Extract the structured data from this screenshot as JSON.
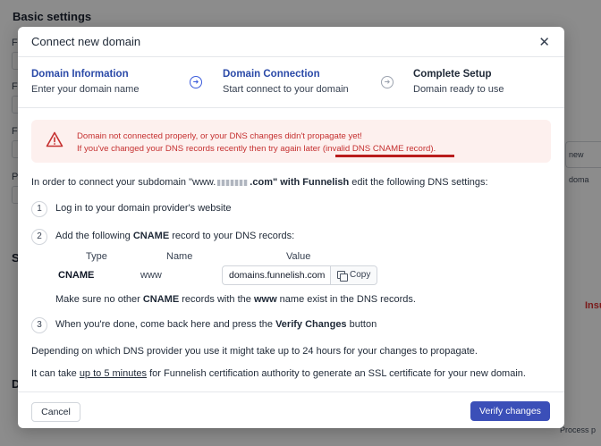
{
  "background": {
    "title": "Basic settings",
    "field_letters": [
      "F",
      "F",
      "F",
      "P"
    ],
    "section_letters": [
      "S",
      "D"
    ],
    "right_fragment": "new doma",
    "red_fragment": "Insu",
    "process_fragment": "Process p"
  },
  "modal": {
    "title": "Connect new domain",
    "close_symbol": "✕",
    "steps": [
      {
        "title": "Domain Information",
        "subtitle": "Enter your domain name"
      },
      {
        "title": "Domain Connection",
        "subtitle": "Start connect to your domain"
      },
      {
        "title": "Complete Setup",
        "subtitle": "Domain ready to use"
      }
    ],
    "alert": {
      "line1": "Domain not connected properly, or your DNS changes didn't propagate yet!",
      "line2": "If you've changed your DNS records recently then try again later (invalid DNS CNAME record)."
    },
    "intro": {
      "before": "In order to connect your subdomain \"www.",
      "after": ".com\" with ",
      "brand": "Funnelish",
      "end": " edit the following DNS settings:"
    },
    "steps_list": {
      "n1": "1",
      "n2": "2",
      "n3": "3",
      "item1": "Log in to your domain provider's website",
      "item2_pre": "Add the following ",
      "item2_bold": "CNAME",
      "item2_post": " record to your DNS records:",
      "item3_pre": "When you're done, come back here and press the ",
      "item3_bold": "Verify Changes",
      "item3_post": " button"
    },
    "dns_table": {
      "headers": [
        "Type",
        "Name",
        "Value"
      ],
      "type": "CNAME",
      "name": "www",
      "value": "domains.funnelish.com",
      "copy_label": "Copy"
    },
    "note": {
      "pre": "Make sure no other ",
      "bold1": "CNAME",
      "mid": " records with the ",
      "bold2": "www",
      "post": " name exist in the DNS records."
    },
    "propagation_text": "Depending on which DNS provider you use it might take up to 24 hours for your changes to propagate.",
    "ssl": {
      "pre": "It can take ",
      "link": "up to 5 minutes",
      "post": " for Funnelish certification authority to generate an SSL certificate for your new domain."
    },
    "cancel_label": "Cancel",
    "verify_label": "Verify changes"
  }
}
